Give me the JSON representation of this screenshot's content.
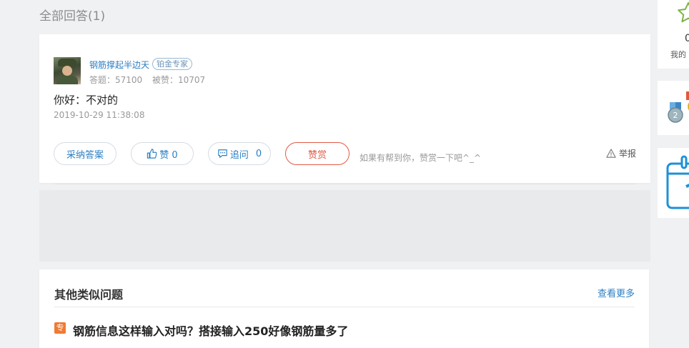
{
  "section": {
    "title": "全部回答(1)"
  },
  "answer": {
    "username": "钢筋撑起半边天",
    "badge": "铂金专家",
    "stats": {
      "answers_label": "答题：57100",
      "likes_label": "被赞：10707"
    },
    "text": "你好：不对的",
    "time": "2019-10-29 11:38:08",
    "actions": {
      "adopt_label": "采纳答案",
      "like_label": "赞 0",
      "followup_label": "追问",
      "followup_count": "0",
      "reward_label": "赞赏",
      "reward_hint": "如果有帮到你，赞赏一下吧^_^",
      "report_label": "举报"
    }
  },
  "similar": {
    "title": "其他类似问题",
    "view_more": "查看更多",
    "questions": [
      {
        "tag": "专",
        "title": "钢筋信息这样输入对吗？搭接输入250好像钢筋量多了"
      }
    ]
  },
  "sidebar": {
    "card1": {
      "count": "0",
      "label": "我的"
    }
  },
  "colors": {
    "link": "#2b7fc4",
    "reward": "#e05a46",
    "tag": "#f07a33",
    "star": "#7cb342",
    "calendar": "#1e90d6"
  },
  "icons": [
    "thumb-up-icon",
    "comment-icon",
    "warning-icon",
    "star-icon",
    "medal-icon",
    "calendar-icon"
  ]
}
